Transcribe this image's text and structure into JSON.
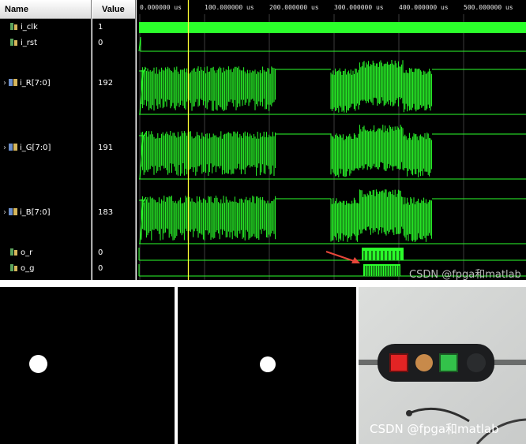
{
  "headers": {
    "name": "Name",
    "value": "Value"
  },
  "signals": [
    {
      "name": "i_clk",
      "value": "1",
      "bus": false,
      "expandable": false
    },
    {
      "name": "i_rst",
      "value": "0",
      "bus": false,
      "expandable": false
    },
    {
      "name": "i_R[7:0]",
      "value": "192",
      "bus": true,
      "expandable": true
    },
    {
      "name": "i_G[7:0]",
      "value": "191",
      "bus": true,
      "expandable": true
    },
    {
      "name": "i_B[7:0]",
      "value": "183",
      "bus": true,
      "expandable": true
    },
    {
      "name": "o_r",
      "value": "0",
      "bus": false,
      "expandable": false
    },
    {
      "name": "o_g",
      "value": "0",
      "bus": false,
      "expandable": false
    }
  ],
  "timeline": {
    "ticks": [
      "0.000000 us",
      "100.000000 us",
      "200.000000 us",
      "300.000000 us",
      "400.000000 us",
      "500.000000 us"
    ],
    "cursor_us": 75
  },
  "colors": {
    "wave": "#2bff2b",
    "cursor": "#ffff33",
    "arrow": "#e8463a",
    "background": "#000000"
  },
  "watermark_top": "CSDN @fpga和matlab",
  "watermark_bottom": "CSDN @fpga和matlab",
  "panels": [
    {
      "name": "binary-mask-red"
    },
    {
      "name": "binary-mask-green"
    },
    {
      "name": "traffic-light-photo",
      "lamps": [
        "red",
        "orange",
        "green",
        "off"
      ]
    }
  ]
}
